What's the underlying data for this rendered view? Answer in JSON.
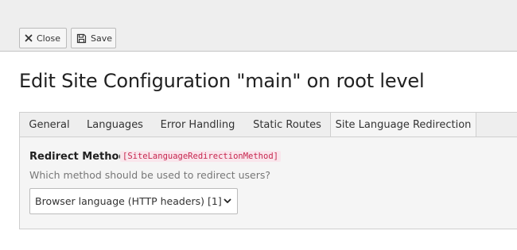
{
  "toolbar": {
    "close_label": "Close",
    "save_label": "Save"
  },
  "page": {
    "title": "Edit Site Configuration \"main\" on root level"
  },
  "tabs": [
    {
      "label": "General",
      "active": false
    },
    {
      "label": "Languages",
      "active": false
    },
    {
      "label": "Error Handling",
      "active": false
    },
    {
      "label": "Static Routes",
      "active": false
    },
    {
      "label": "Site Language Redirection",
      "active": true
    }
  ],
  "field": {
    "label": "Redirect Method",
    "code": "[SiteLanguageRedirectionMethod]",
    "description": "Which method should be used to redirect users?",
    "selected_value": "Browser language (HTTP headers) [1]"
  },
  "icons": {
    "close": "close-icon",
    "save": "save-icon",
    "dropdown": "chevron-down-icon"
  },
  "colors": {
    "code_text": "#c7254e",
    "code_bg": "#f9e6ec",
    "tab_bar_bg": "#eeeeee",
    "panel_bg": "#f5f5f5"
  }
}
